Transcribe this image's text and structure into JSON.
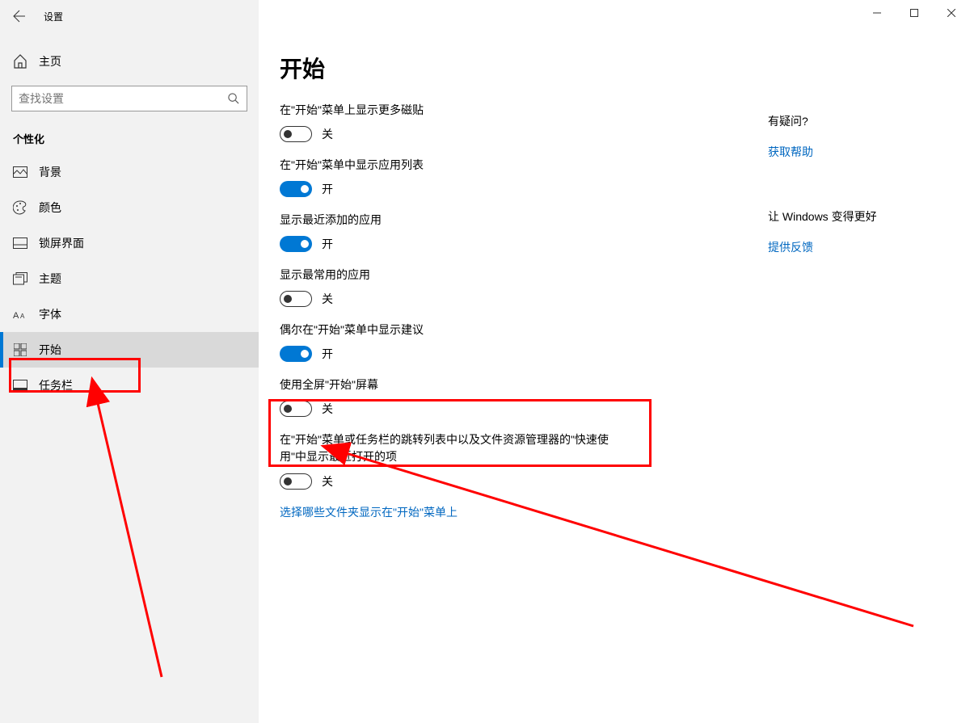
{
  "window": {
    "title": "设置"
  },
  "sidebar": {
    "home_label": "主页",
    "search_placeholder": "查找设置",
    "section_header": "个性化",
    "items": [
      {
        "label": "背景"
      },
      {
        "label": "颜色"
      },
      {
        "label": "锁屏界面"
      },
      {
        "label": "主题"
      },
      {
        "label": "字体"
      },
      {
        "label": "开始"
      },
      {
        "label": "任务栏"
      }
    ]
  },
  "page": {
    "title": "开始",
    "settings": [
      {
        "label": "在\"开始\"菜单上显示更多磁贴",
        "on": false,
        "state": "关"
      },
      {
        "label": "在\"开始\"菜单中显示应用列表",
        "on": true,
        "state": "开"
      },
      {
        "label": "显示最近添加的应用",
        "on": true,
        "state": "开"
      },
      {
        "label": "显示最常用的应用",
        "on": false,
        "state": "关"
      },
      {
        "label": "偶尔在\"开始\"菜单中显示建议",
        "on": true,
        "state": "开"
      },
      {
        "label": "使用全屏\"开始\"屏幕",
        "on": false,
        "state": "关"
      },
      {
        "label": "在\"开始\"菜单或任务栏的跳转列表中以及文件资源管理器的\"快速使用\"中显示最近打开的项",
        "on": false,
        "state": "关"
      }
    ],
    "folder_link": "选择哪些文件夹显示在\"开始\"菜单上"
  },
  "right": {
    "help_heading": "有疑问?",
    "help_link": "获取帮助",
    "feedback_heading": "让 Windows 变得更好",
    "feedback_link": "提供反馈"
  }
}
